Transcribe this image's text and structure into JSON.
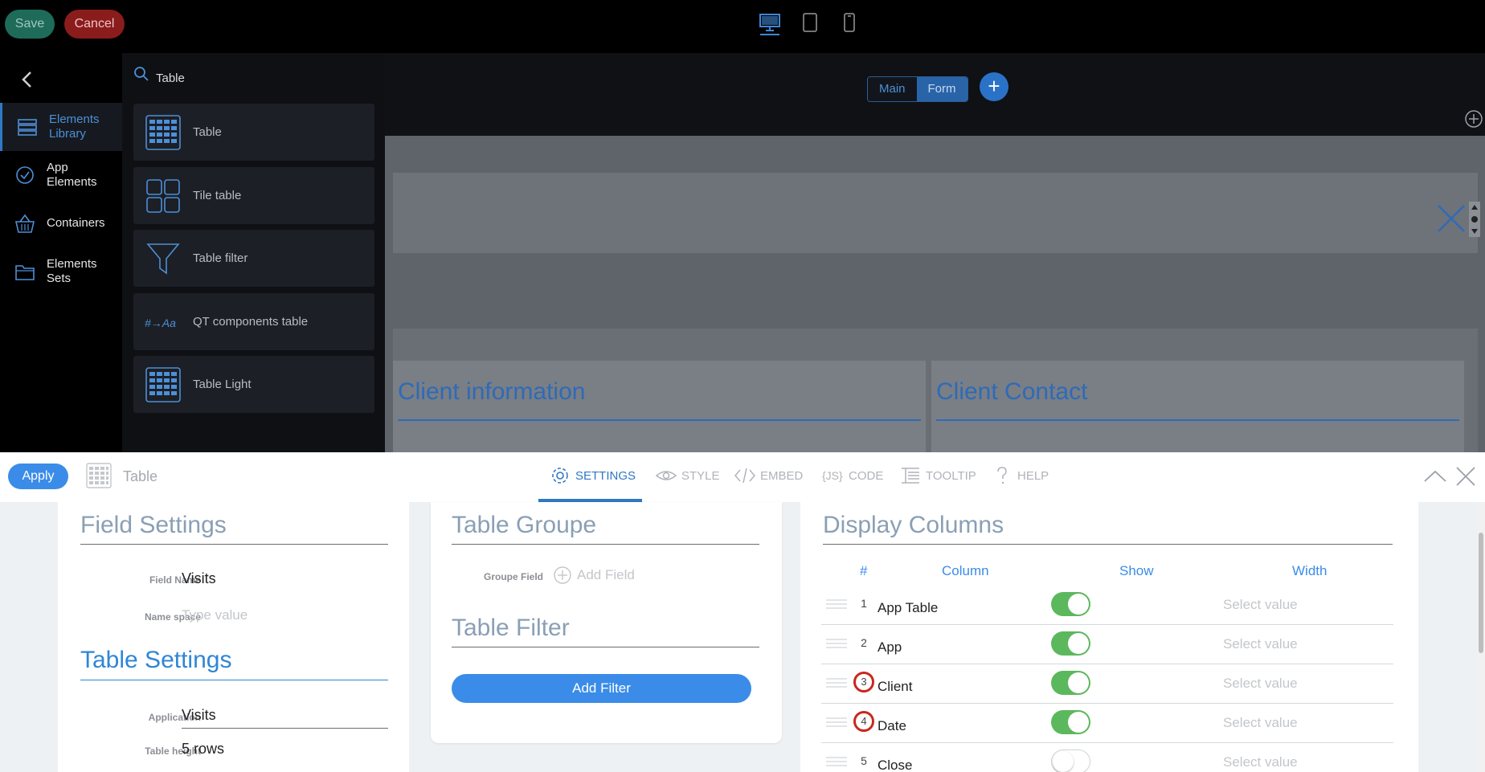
{
  "topbar": {
    "save_label": "Save",
    "cancel_label": "Cancel",
    "devices": [
      "desktop-icon",
      "tablet-icon",
      "phone-icon"
    ]
  },
  "rail": {
    "items": [
      {
        "label": "Elements Library",
        "icon": "layers-icon",
        "active": true
      },
      {
        "label": "App Elements",
        "icon": "check-circle-icon",
        "active": false
      },
      {
        "label": "Containers",
        "icon": "basket-icon",
        "active": false
      },
      {
        "label": "Elements Sets",
        "icon": "folder-icon",
        "active": false
      }
    ]
  },
  "library": {
    "search_value": "Table",
    "cards": [
      {
        "label": "Table",
        "icon": "table-grid-icon"
      },
      {
        "label": "Tile table",
        "icon": "tile-grid-icon"
      },
      {
        "label": "Table filter",
        "icon": "funnel-icon"
      },
      {
        "label": "QT components table",
        "icon": "hash-to-text-icon"
      },
      {
        "label": "Table Light",
        "icon": "table-grid-icon"
      }
    ]
  },
  "canvas": {
    "segments": [
      "Main",
      "Form"
    ],
    "add_label": "+",
    "client_info_title": "Client information",
    "client_contact_title": "Client Contact"
  },
  "settings": {
    "apply_label": "Apply",
    "element_title": "Table",
    "tabs": [
      {
        "label": "SETTINGS",
        "icon": "gear-icon",
        "active": true
      },
      {
        "label": "STYLE",
        "icon": "eye-icon",
        "active": false
      },
      {
        "label": "EMBED",
        "icon": "code-brackets-icon",
        "active": false
      },
      {
        "label": "CODE",
        "icon": "js-braces-icon",
        "active": false
      },
      {
        "label": "TOOLTIP",
        "icon": "tooltip-lines-icon",
        "active": false
      },
      {
        "label": "HELP",
        "icon": "question-icon",
        "active": false
      }
    ],
    "field_settings": {
      "title": "Field Settings",
      "field_name_label": "Field Name",
      "field_name_value": "Visits",
      "name_space_label": "Name space",
      "name_space_placeholder": "Type value"
    },
    "table_settings": {
      "title": "Table Settings",
      "application_label": "Application",
      "application_value": "Visits",
      "table_height_label": "Table height",
      "table_height_value": "5 rows"
    },
    "table_groupe": {
      "title": "Table Groupe",
      "groupe_field_label": "Groupe Field",
      "add_field_label": "Add Field"
    },
    "table_filter": {
      "title": "Table Filter",
      "add_filter_label": "Add Filter"
    },
    "display_columns": {
      "title": "Display Columns",
      "headers": {
        "num": "#",
        "column": "Column",
        "show": "Show",
        "width": "Width"
      },
      "rows": [
        {
          "num": "1",
          "name": "App Table",
          "show": true,
          "width": "Select value",
          "highlighted": false
        },
        {
          "num": "2",
          "name": "App",
          "show": true,
          "width": "Select value",
          "highlighted": false
        },
        {
          "num": "3",
          "name": "Client",
          "show": true,
          "width": "Select value",
          "highlighted": true
        },
        {
          "num": "4",
          "name": "Date",
          "show": true,
          "width": "Select value",
          "highlighted": true
        },
        {
          "num": "5",
          "name": "Close",
          "show": false,
          "width": "Select value",
          "highlighted": false
        }
      ]
    }
  },
  "colors": {
    "accent": "#2f78c4",
    "toggle_on": "#5cb85c",
    "highlight_ring": "#c9271e",
    "save": "#1e6b5a",
    "cancel": "#8a1c1c"
  }
}
